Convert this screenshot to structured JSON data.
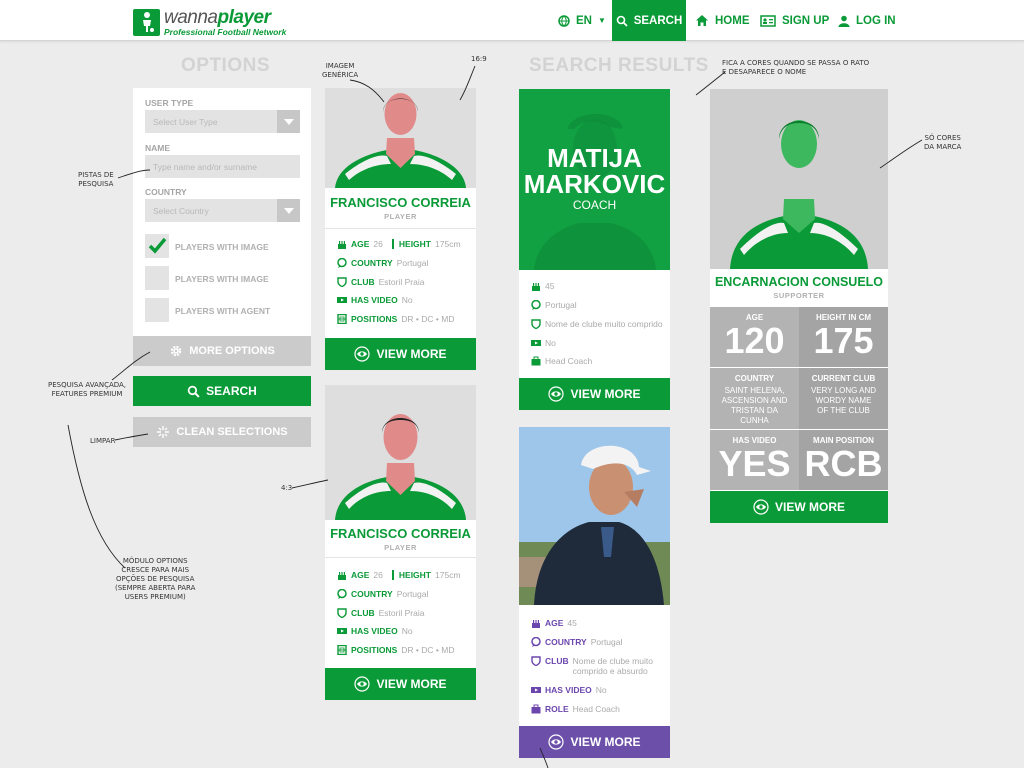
{
  "brand": {
    "wordmark_a": "wanna",
    "wordmark_b": "player",
    "tagline": "Professional Football Network",
    "green": "#0a9a37",
    "purple": "#6b4fa8"
  },
  "nav": {
    "lang": "EN",
    "search": "SEARCH",
    "home": "HOME",
    "signup": "SIGN UP",
    "login": "LOG IN"
  },
  "options": {
    "title": "OPTIONS",
    "user_type_label": "USER TYPE",
    "user_type_placeholder": "Select User Type",
    "name_label": "NAME",
    "name_placeholder": "Type name and/or surname",
    "country_label": "COUNTRY",
    "country_placeholder": "Select Country",
    "checkboxes": [
      {
        "label": "PLAYERS WITH IMAGE",
        "checked": true
      },
      {
        "label": "PLAYERS WITH IMAGE",
        "checked": false
      },
      {
        "label": "PLAYERS WITH AGENT",
        "checked": false
      }
    ],
    "more_options": "MORE OPTIONS",
    "search": "SEARCH",
    "clean": "CLEAN SELECTIONS"
  },
  "results_title": "SEARCH RESULTS",
  "cards": {
    "player1": {
      "name": "FRANCISCO CORREIA",
      "role": "PLAYER",
      "age_k": "AGE",
      "age_v": "26",
      "height_k": "HEIGHT",
      "height_v": "175cm",
      "country_k": "COUNTRY",
      "country_v": "Portugal",
      "club_k": "CLUB",
      "club_v": "Estoril Praia",
      "video_k": "HAS VIDEO",
      "video_v": "No",
      "pos_k": "POSITIONS",
      "pos_v": "DR • DC • MD",
      "view": "VIEW MORE"
    },
    "player2": {
      "name": "FRANCISCO CORREIA",
      "role": "PLAYER",
      "age_k": "AGE",
      "age_v": "26",
      "height_k": "HEIGHT",
      "height_v": "175cm",
      "country_k": "COUNTRY",
      "country_v": "Portugal",
      "club_k": "CLUB",
      "club_v": "Estoril Praia",
      "video_k": "HAS VIDEO",
      "video_v": "No",
      "pos_k": "POSITIONS",
      "pos_v": "DR • DC • MD",
      "view": "VIEW MORE"
    },
    "coach": {
      "first": "MATIJA",
      "last": "MARKOVIC",
      "role": "COACH",
      "age_v": "45",
      "country_v": "Portugal",
      "club_v": "Nome de clube muito comprido",
      "video_v": "No",
      "role_v": "Head Coach",
      "view": "VIEW MORE"
    },
    "photo_coach": {
      "age_k": "AGE",
      "age_v": "45",
      "country_k": "COUNTRY",
      "country_v": "Portugal",
      "club_k": "CLUB",
      "club_v1": "Nome de clube muito",
      "club_v2": "comprido e absurdo",
      "video_k": "HAS VIDEO",
      "video_v": "No",
      "role_k": "ROLE",
      "role_v": "Head Coach",
      "view": "VIEW MORE"
    },
    "supporter": {
      "name": "ENCARNACION CONSUELO",
      "role": "SUPPORTER",
      "age_t": "AGE",
      "age_v": "120",
      "height_t": "HEIGHT IN CM",
      "height_v": "175",
      "country_t": "COUNTRY",
      "country_l1": "SAINT HELENA,",
      "country_l2": "ASCENSION AND",
      "country_l3": "TRISTAN DA CUNHA",
      "club_t": "CURRENT CLUB",
      "club_l1": "VERY LONG AND",
      "club_l2": "WORDY NAME",
      "club_l3": "OF THE CLUB",
      "video_t": "HAS VIDEO",
      "video_v": "YES",
      "pos_t": "MAIN POSITION",
      "pos_v": "RCB",
      "view": "VIEW MORE"
    }
  },
  "annotations": {
    "imagem_1": "IMAGEM",
    "imagem_2": "GENÉRICA",
    "ratio_169": "16:9",
    "ratio_43": "4:3",
    "pistas_1": "PISTAS DE",
    "pistas_2": "PESQUISA",
    "avancada_1": "PESQUISA AVANÇADA,",
    "avancada_2": "FEATURES PREMIUM",
    "limpar": "LIMPAR",
    "modulo_1": "MÓDULO OPTIONS",
    "modulo_2": "CRESCE PARA MAIS",
    "modulo_3": "OPÇÕES DE PESQUISA",
    "modulo_4": "(SEMPRE ABERTA PARA",
    "modulo_5": "USERS PREMIUM)",
    "cores_1": "FICA A CORES QUANDO SE PASSA O RATO",
    "cores_2": "E DESAPARECE O NOME",
    "marca_1": "SÓ CORES",
    "marca_2": "DA MARCA"
  }
}
